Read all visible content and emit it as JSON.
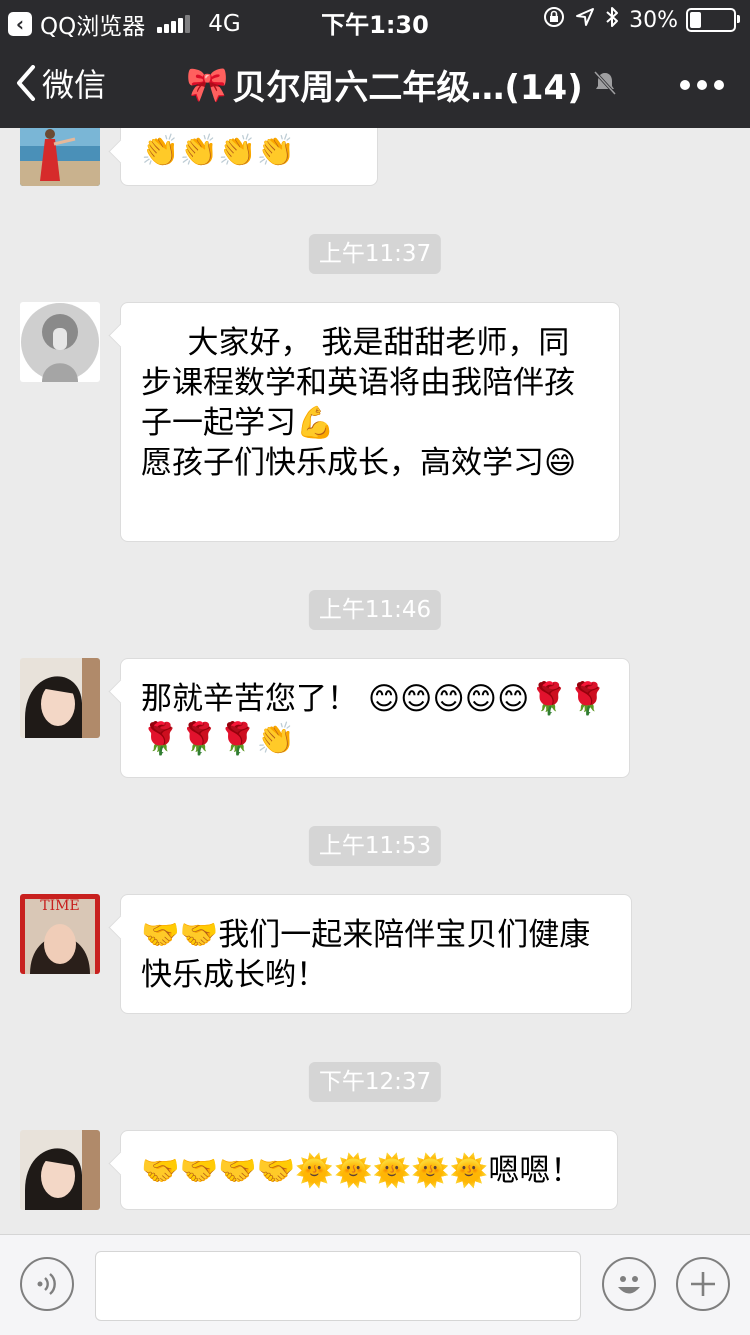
{
  "status_bar": {
    "app_label": "QQ浏览器",
    "network": "4G",
    "time": "下午1:30",
    "battery": "30%",
    "battery_level": 0.3
  },
  "nav": {
    "back_label": "微信",
    "title": "贝尔周六二年级…(14)",
    "title_emoji": "🎀"
  },
  "messages": [
    {
      "type": "msg",
      "avatar": "avatar-beach",
      "text": "👏👏👏👏"
    },
    {
      "type": "time",
      "text": "上午11:37"
    },
    {
      "type": "msg",
      "avatar": "avatar-bw",
      "text": "大家好， 我是甜甜老师，同步课程数学和英语将由我陪伴孩子一起学习💪\n愿孩子们快乐成长，高效学习😄"
    },
    {
      "type": "time",
      "text": "上午11:46"
    },
    {
      "type": "msg",
      "avatar": "avatar-woman",
      "text": "那就辛苦您了！ 😊😊😊😊😊🌹🌹🌹🌹🌹👏"
    },
    {
      "type": "time",
      "text": "上午11:53"
    },
    {
      "type": "msg",
      "avatar": "avatar-time",
      "avatar_text": "TIME",
      "text": "🤝🤝我们一起来陪伴宝贝们健康快乐成长哟！"
    },
    {
      "type": "time",
      "text": "下午12:37"
    },
    {
      "type": "msg",
      "avatar": "avatar-woman",
      "text": "🤝🤝🤝🤝🌞🌞🌞🌞🌞嗯嗯！"
    }
  ],
  "input_bar": {
    "voice_icon": "voice-icon",
    "emoji_icon": "smiley-icon",
    "add_icon": "plus-icon",
    "placeholder": ""
  },
  "colors": {
    "topbar": "#2b2b2e",
    "chat_bg": "#ebebeb",
    "time_chip": "#d5d5d5"
  }
}
